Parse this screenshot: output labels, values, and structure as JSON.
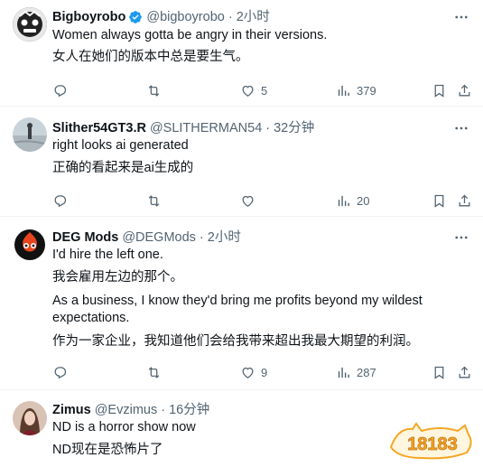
{
  "tweets": [
    {
      "name": "Bigboyrobo",
      "handle": "@bigboyrobo",
      "time": "2小时",
      "verified": true,
      "lines": [
        "Women always gotta be angry in their versions.",
        "女人在她们的版本中总是要生气。"
      ],
      "likes": "5",
      "views": "379",
      "retweets": ""
    },
    {
      "name": "Slither54GT3.R",
      "handle": "@SLITHERMAN54",
      "time": "32分钟",
      "verified": false,
      "lines": [
        "right looks ai generated",
        "正确的看起来是ai生成的"
      ],
      "likes": "",
      "views": "20",
      "retweets": ""
    },
    {
      "name": "DEG Mods",
      "handle": "@DEGMods",
      "time": "2小时",
      "verified": false,
      "lines": [
        "I'd hire the left one.",
        "我会雇用左边的那个。",
        "As a business, I know they'd bring me profits beyond my wildest",
        "expectations.",
        "作为一家企业，我知道他们会给我带来超出我最大期望的利润。"
      ],
      "likes": "9",
      "views": "287",
      "retweets": ""
    },
    {
      "name": "Zimus",
      "handle": "@Evzimus",
      "time": "16分钟",
      "verified": false,
      "lines": [
        "ND is a horror show now",
        "ND现在是恐怖片了"
      ]
    }
  ],
  "separator_dot": "·",
  "watermark_text": "18183",
  "colors": {
    "secondary": "#536471",
    "primary_text": "#0f1419",
    "verified_blue": "#1d9bf0",
    "divider": "#eff3f4",
    "watermark": "#f5a623"
  },
  "icons": [
    "verified-badge-icon",
    "more-icon",
    "reply-icon",
    "retweet-icon",
    "like-icon",
    "views-icon",
    "bookmark-icon",
    "share-icon"
  ]
}
